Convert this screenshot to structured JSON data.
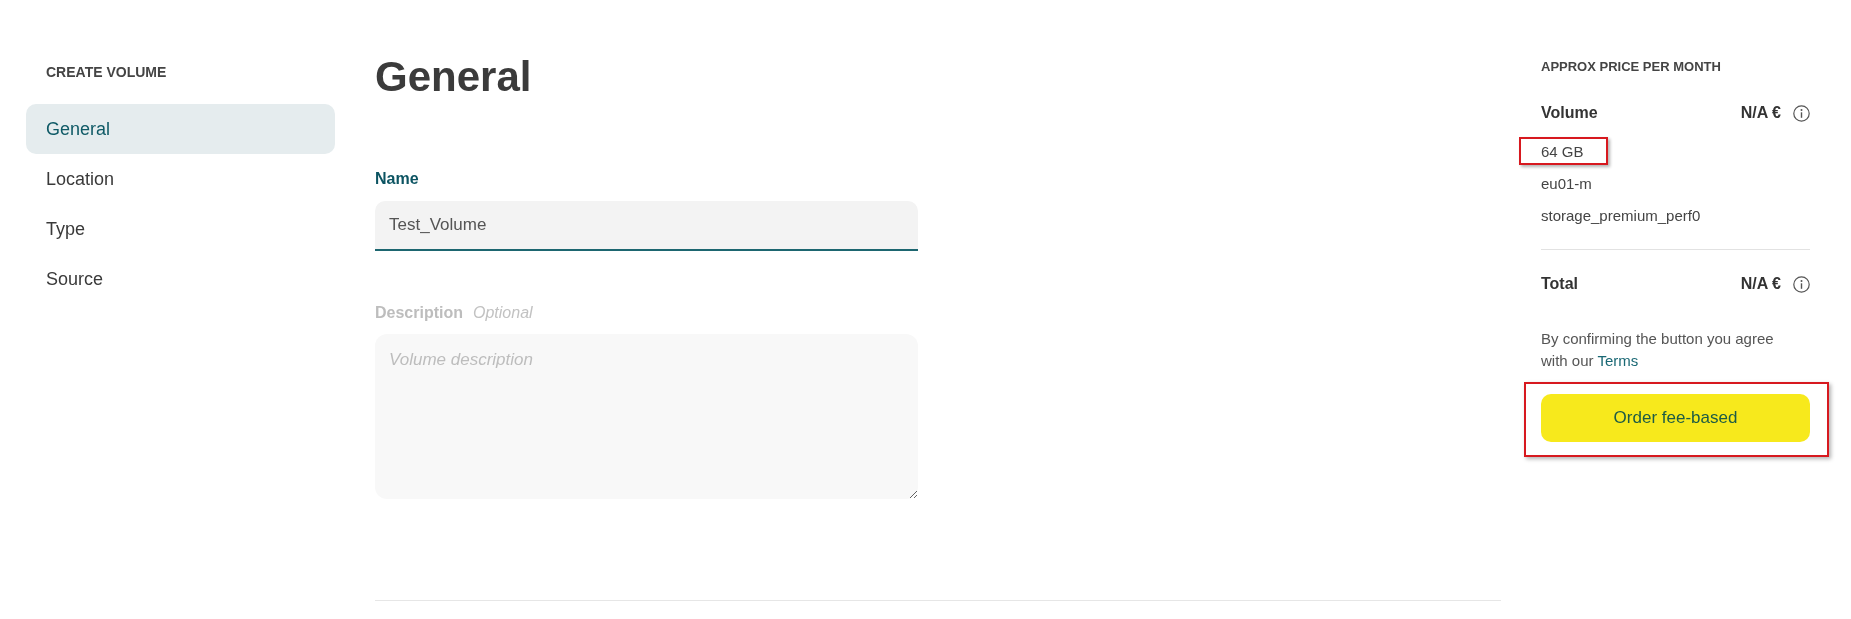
{
  "sidebar": {
    "title": "CREATE VOLUME",
    "items": [
      {
        "label": "General",
        "selected": true
      },
      {
        "label": "Location",
        "selected": false
      },
      {
        "label": "Type",
        "selected": false
      },
      {
        "label": "Source",
        "selected": false
      }
    ]
  },
  "form": {
    "heading": "General",
    "fields": [
      {
        "kind": "input",
        "label": "Name",
        "value": "Test_Volume",
        "focused": true
      },
      {
        "kind": "textarea",
        "label": "Description",
        "hint": "Optional",
        "placeholder": "Volume description",
        "focused": false
      }
    ]
  },
  "summary": {
    "title": "APPROX PRICE PER MONTH",
    "items": [
      {
        "label": "Volume",
        "price": "N/A €",
        "details": [
          {
            "text": "64 GB",
            "highlighted": true
          },
          {
            "text": "eu01-m",
            "highlighted": false
          },
          {
            "text": "storage_premium_perf0",
            "highlighted": false
          }
        ]
      }
    ],
    "total": {
      "label": "Total",
      "price": "N/A €"
    },
    "agreement": {
      "text": "By confirming the button you agree with our",
      "link": "Terms"
    },
    "order_button": {
      "label": "Order fee-based",
      "highlighted": true
    }
  }
}
